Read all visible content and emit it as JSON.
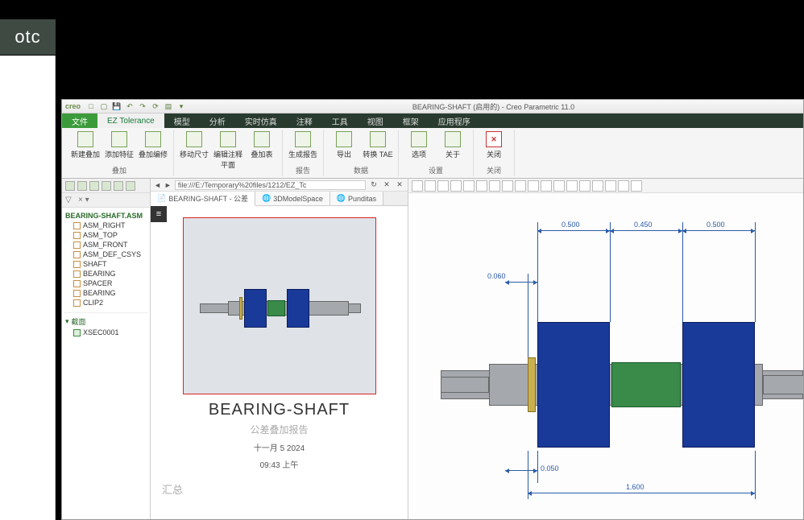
{
  "outer": {
    "ptc_label": "otc"
  },
  "titlebar": {
    "app_logo": "creo",
    "title": "BEARING-SHAFT (启用的) - Creo Parametric 11.0"
  },
  "ribbon_tabs": {
    "file": "文件",
    "active": "EZ Tolerance",
    "others": [
      "模型",
      "分析",
      "实时仿真",
      "注释",
      "工具",
      "视图",
      "框架",
      "应用程序"
    ]
  },
  "ribbon": {
    "group1": {
      "btns": [
        "新建叠加",
        "添加特征",
        "叠加编修"
      ],
      "label": "叠加"
    },
    "group2": {
      "btns": [
        "移动尺寸",
        "编辑注释平面",
        "叠加表"
      ],
      "label": ""
    },
    "group3": {
      "btns": [
        "生成报告"
      ],
      "label": "报告"
    },
    "group4": {
      "btns": [
        "导出",
        "转换 TAE"
      ],
      "label": "数据"
    },
    "group5": {
      "btns": [
        "选项",
        "关于"
      ],
      "label": "设置"
    },
    "group6": {
      "btns": [
        "关闭"
      ],
      "label": "关闭"
    }
  },
  "tree": {
    "root": "BEARING-SHAFT.ASM",
    "items": [
      "ASM_RIGHT",
      "ASM_TOP",
      "ASM_FRONT",
      "ASM_DEF_CSYS",
      "SHAFT",
      "BEARING",
      "SPACER",
      "BEARING",
      "CLIP2"
    ],
    "section_label": "截面",
    "xsec": "XSEC0001"
  },
  "address": {
    "url": "file:///E:/Temporary%20files/1212/EZ_Tc"
  },
  "doc_tabs": [
    "BEARING-SHAFT - 公差",
    "3DModelSpace",
    "Punditas"
  ],
  "report": {
    "title": "BEARING-SHAFT",
    "subtitle": "公差叠加报告",
    "date": "十一月 5 2024",
    "time": "09:43 上午",
    "summary": "汇总"
  },
  "dims": {
    "d1": "0.500",
    "d2": "0.450",
    "d3": "0.500",
    "d4": "0.060",
    "d5": "0.050",
    "d6": "1.600"
  }
}
